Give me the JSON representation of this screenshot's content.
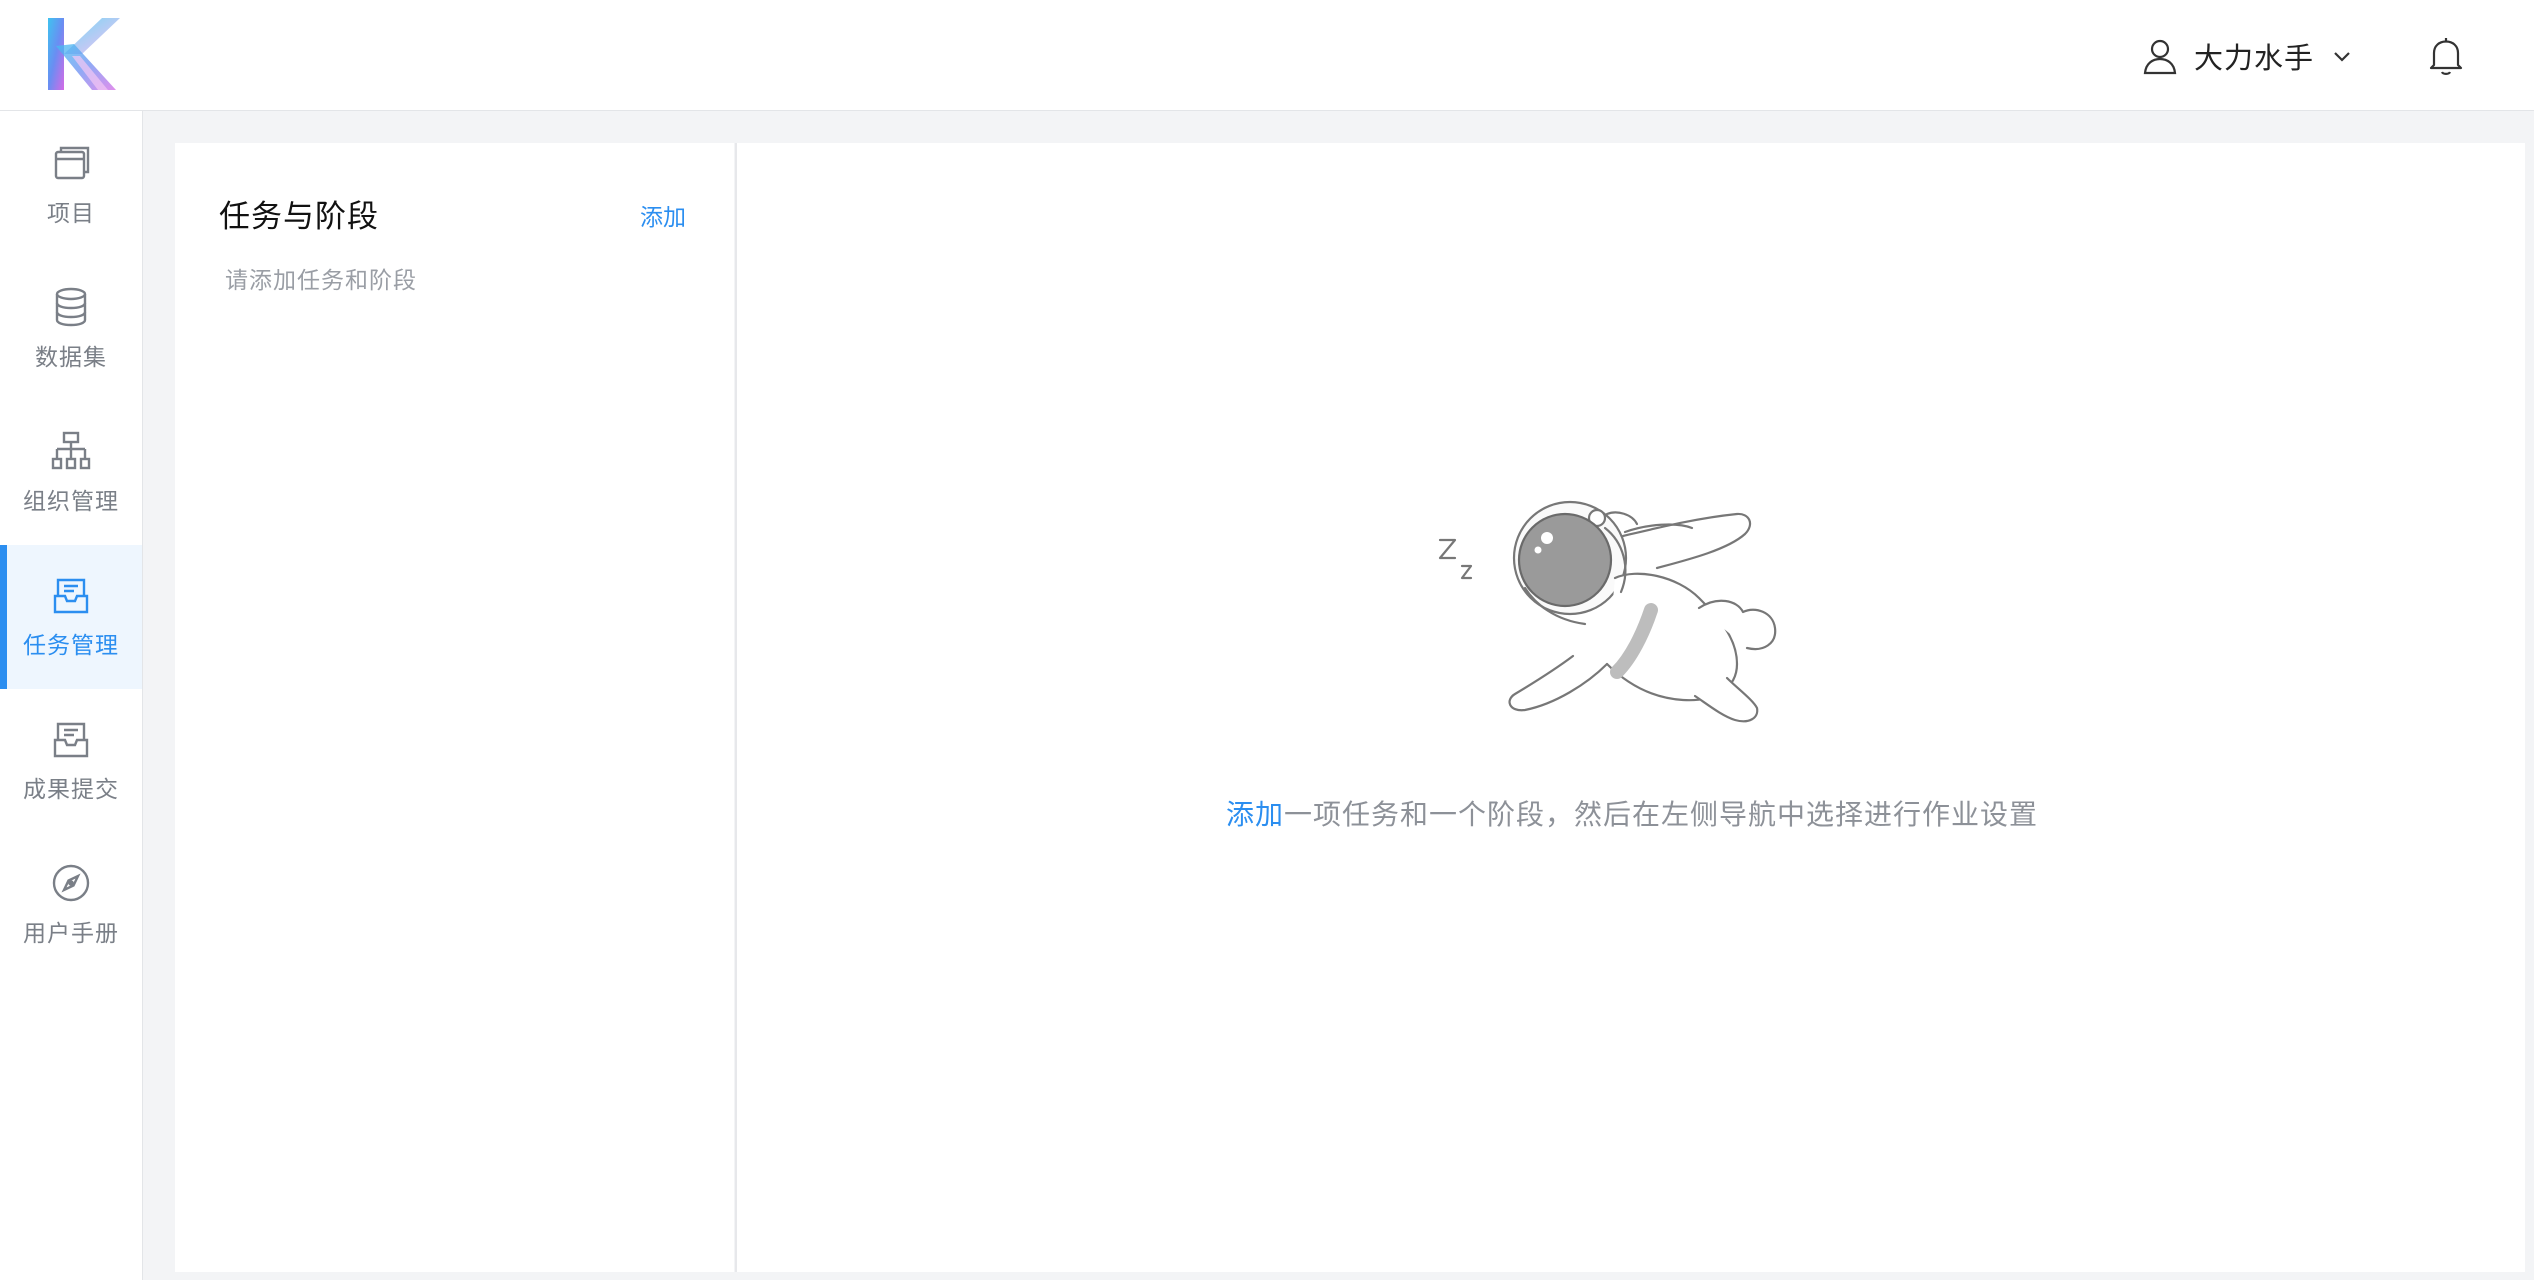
{
  "header": {
    "user_name": "大力水手"
  },
  "sidebar": {
    "items": [
      {
        "label": "项目",
        "icon": "browser-icon",
        "active": false
      },
      {
        "label": "数据集",
        "icon": "database-icon",
        "active": false
      },
      {
        "label": "组织管理",
        "icon": "org-chart-icon",
        "active": false
      },
      {
        "label": "任务管理",
        "icon": "task-inbox-icon",
        "active": true
      },
      {
        "label": "成果提交",
        "icon": "submit-inbox-icon",
        "active": false
      },
      {
        "label": "用户手册",
        "icon": "compass-icon",
        "active": false
      }
    ]
  },
  "task_panel": {
    "title": "任务与阶段",
    "add_label": "添加",
    "hint": "请添加任务和阶段"
  },
  "main": {
    "empty_link": "添加",
    "empty_text": "一项任务和一个阶段，然后在左侧导航中选择进行作业设置"
  },
  "colors": {
    "accent": "#2b8ef0",
    "sidebar_active_bg": "#eef6fe",
    "page_bg": "#f3f4f6"
  }
}
